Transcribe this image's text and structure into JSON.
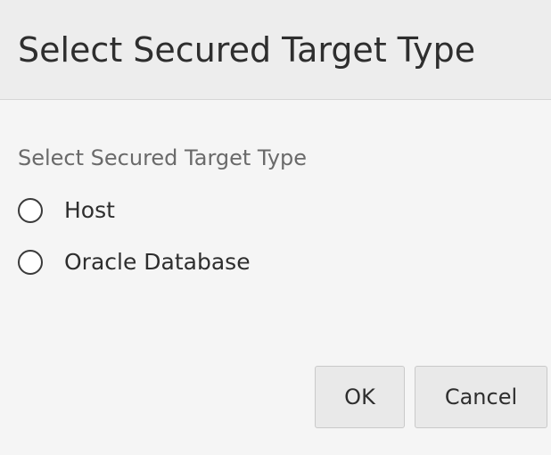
{
  "dialog": {
    "title": "Select Secured Target Type"
  },
  "form": {
    "section_label": "Select Secured Target Type",
    "options": [
      {
        "label": "Host",
        "selected": false
      },
      {
        "label": "Oracle Database",
        "selected": false
      }
    ]
  },
  "buttons": {
    "ok_label": "OK",
    "cancel_label": "Cancel"
  },
  "colors": {
    "background": "#f5f5f5",
    "header_background": "#ededed",
    "text": "#2e2e2e",
    "muted_text": "#6a6a6a",
    "button_background": "#e9e9e9"
  },
  "icons": {
    "radio": "radio-unselected-icon"
  }
}
